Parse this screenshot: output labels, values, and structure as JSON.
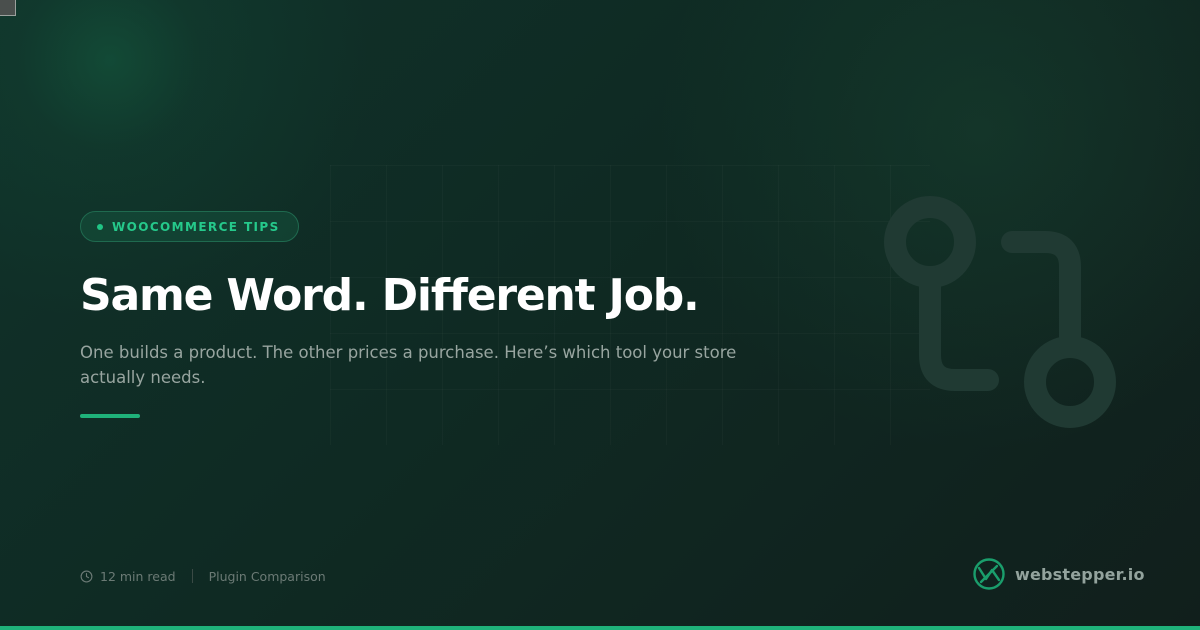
{
  "tag": {
    "label": "WOOCOMMERCE TIPS"
  },
  "headline": "Same Word. Different Job.",
  "subtitle": "One builds a product. The other prices a purchase. Here’s which tool your store actually needs.",
  "meta": {
    "read_time": "12 min read",
    "category": "Plugin Comparison",
    "icon": "clock-icon"
  },
  "brand": {
    "name": "webstepper.io",
    "icon": "webstepper-logo-icon"
  },
  "decoration": {
    "icon": "git-compare-icon"
  },
  "colors": {
    "accent": "#1fb27a",
    "tag_text": "#25c98b",
    "headline": "#ffffff",
    "subtitle": "#98a5a0",
    "background": "#0f2a23"
  }
}
